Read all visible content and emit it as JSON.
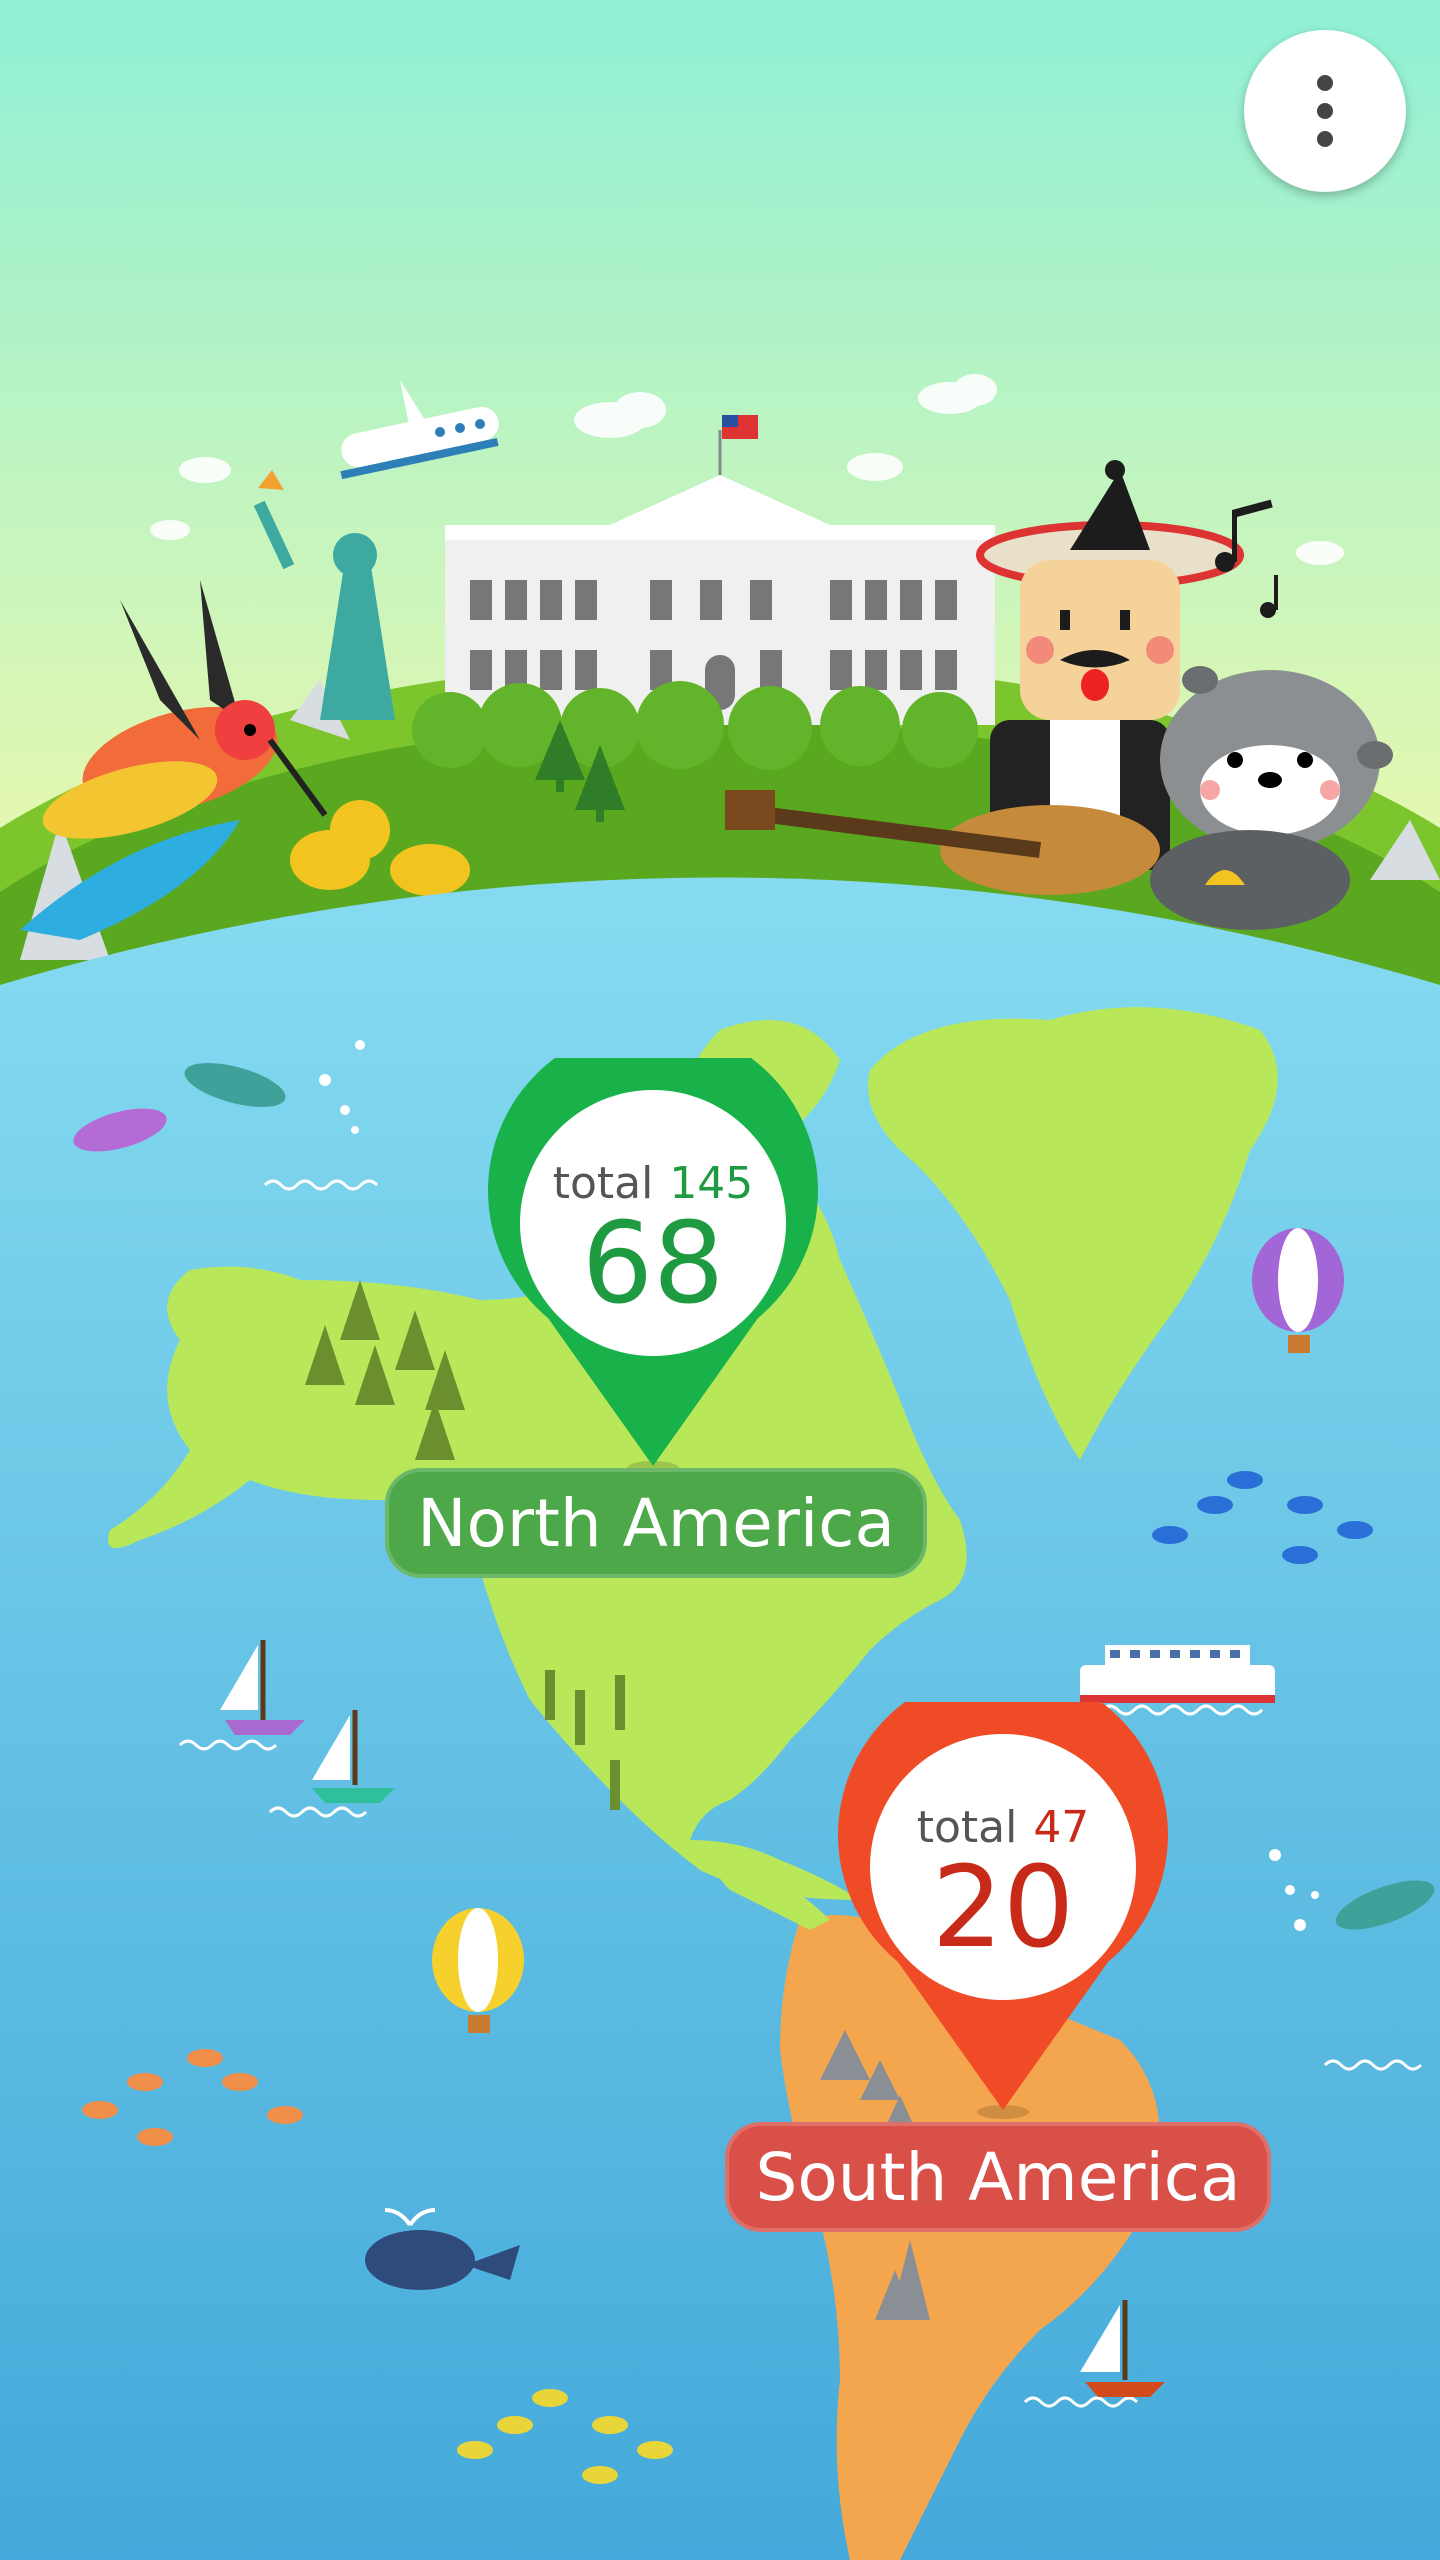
{
  "menu": {
    "icon": "more-vert-icon"
  },
  "regions": [
    {
      "name": "North America",
      "total_label": "total",
      "total": "145",
      "count": "68",
      "color": "#19b24a",
      "label_color": "#4da84a",
      "text_color": "#1e9a40"
    },
    {
      "name": "South America",
      "total_label": "total",
      "total": "47",
      "count": "20",
      "color": "#ef4b26",
      "label_color": "#d85048",
      "text_color": "#c72a18"
    }
  ],
  "colors": {
    "sky_top": "#8ff0d6",
    "sky_bottom": "#f6f9a8",
    "ocean": "#55bde3",
    "land_north": "#b8e85a",
    "land_south": "#f4a64e",
    "hill": "#7cc52c"
  }
}
